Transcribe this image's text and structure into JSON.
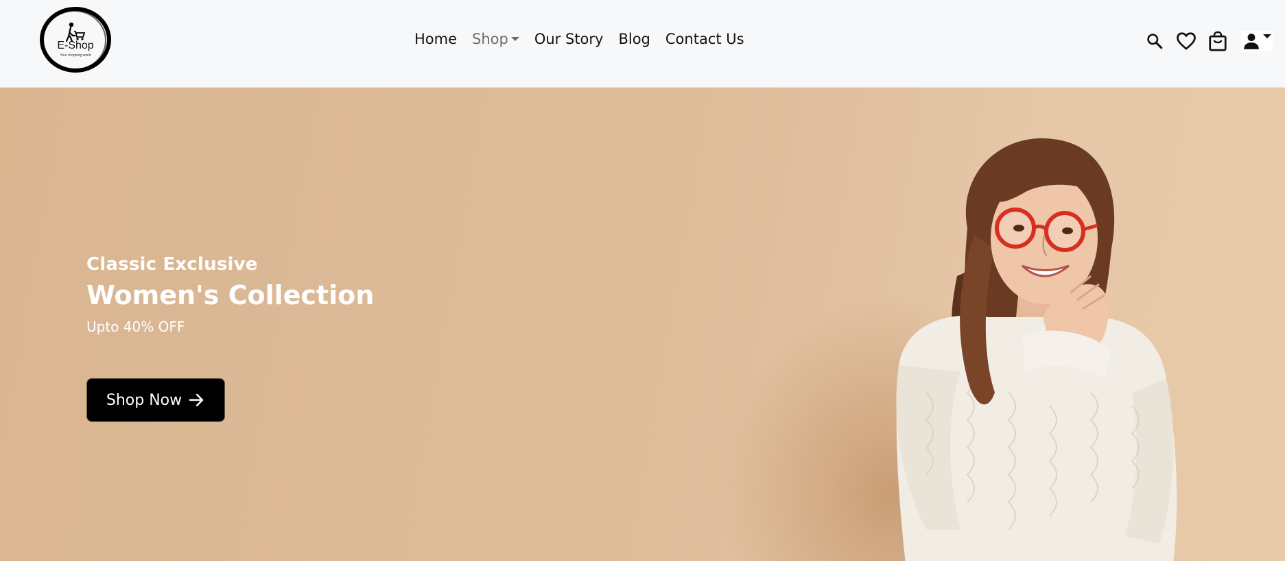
{
  "brand": {
    "name": "E-Shop",
    "tagline": "Your shopping world"
  },
  "nav": {
    "items": [
      {
        "label": "Home"
      },
      {
        "label": "Shop"
      },
      {
        "label": "Our Story"
      },
      {
        "label": "Blog"
      },
      {
        "label": "Contact Us"
      }
    ]
  },
  "header_icons": [
    "search-icon",
    "heart-icon",
    "shopping-bag-icon",
    "user-icon"
  ],
  "hero": {
    "eyebrow": "Classic Exclusive",
    "headline": "Women's Collection",
    "offer": "Upto 40% OFF",
    "cta_label": "Shop Now"
  },
  "colors": {
    "header_bg": "#f7f8fa",
    "hero_bg": "#dcb997",
    "cta_bg": "#000000",
    "text_light": "#ffffff"
  }
}
